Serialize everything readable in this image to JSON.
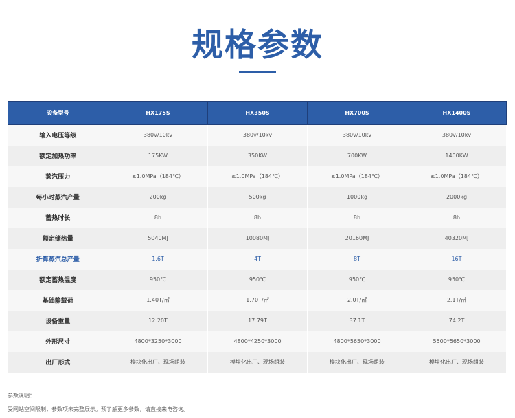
{
  "title": "规格参数",
  "table": {
    "headers": [
      "设备型号",
      "HX175S",
      "HX350S",
      "HX700S",
      "HX1400S"
    ],
    "rows": [
      {
        "label": "输入电压等级",
        "values": [
          "380v/10kv",
          "380v/10kv",
          "380v/10kv",
          "380v/10kv"
        ]
      },
      {
        "label": "额定加热功率",
        "values": [
          "175KW",
          "350KW",
          "700KW",
          "1400KW"
        ]
      },
      {
        "label": "蒸汽压力",
        "values": [
          "≤1.0MPa（184℃）",
          "≤1.0MPa（184℃）",
          "≤1.0MPa（184℃）",
          "≤1.0MPa（184℃）"
        ]
      },
      {
        "label": "每小时蒸汽产量",
        "values": [
          "200kg",
          "500kg",
          "1000kg",
          "2000kg"
        ]
      },
      {
        "label": "蓄热时长",
        "values": [
          "8h",
          "8h",
          "8h",
          "8h"
        ]
      },
      {
        "label": "额定储热量",
        "values": [
          "5040MJ",
          "10080MJ",
          "20160MJ",
          "40320MJ"
        ]
      },
      {
        "label": "折算蒸汽总产量",
        "values": [
          "1.6T",
          "4T",
          "8T",
          "16T"
        ]
      },
      {
        "label": "额定蓄热温度",
        "values": [
          "950℃",
          "950℃",
          "950℃",
          "950℃"
        ]
      },
      {
        "label": "基础静载荷",
        "values": [
          "1.40T/㎡",
          "1.70T/㎡",
          "2.0T/㎡",
          "2.1T/㎡"
        ]
      },
      {
        "label": "设备重量",
        "values": [
          "12.20T",
          "17.79T",
          "37.1T",
          "74.2T"
        ]
      },
      {
        "label": "外形尺寸",
        "values": [
          "4800*3250*3000",
          "4800*4250*3000",
          "4800*5650*3000",
          "5500*5650*3000"
        ]
      },
      {
        "label": "出厂形式",
        "values": [
          "模块化出厂、现场组装",
          "模块化出厂、现场组装",
          "模块化出厂、现场组装",
          "模块化出厂、现场组装"
        ]
      }
    ]
  },
  "notes": {
    "heading": "参数说明：",
    "text": "受网站空间限制，参数项未完整展示。预了解更多参数，请直接来电咨询。"
  }
}
